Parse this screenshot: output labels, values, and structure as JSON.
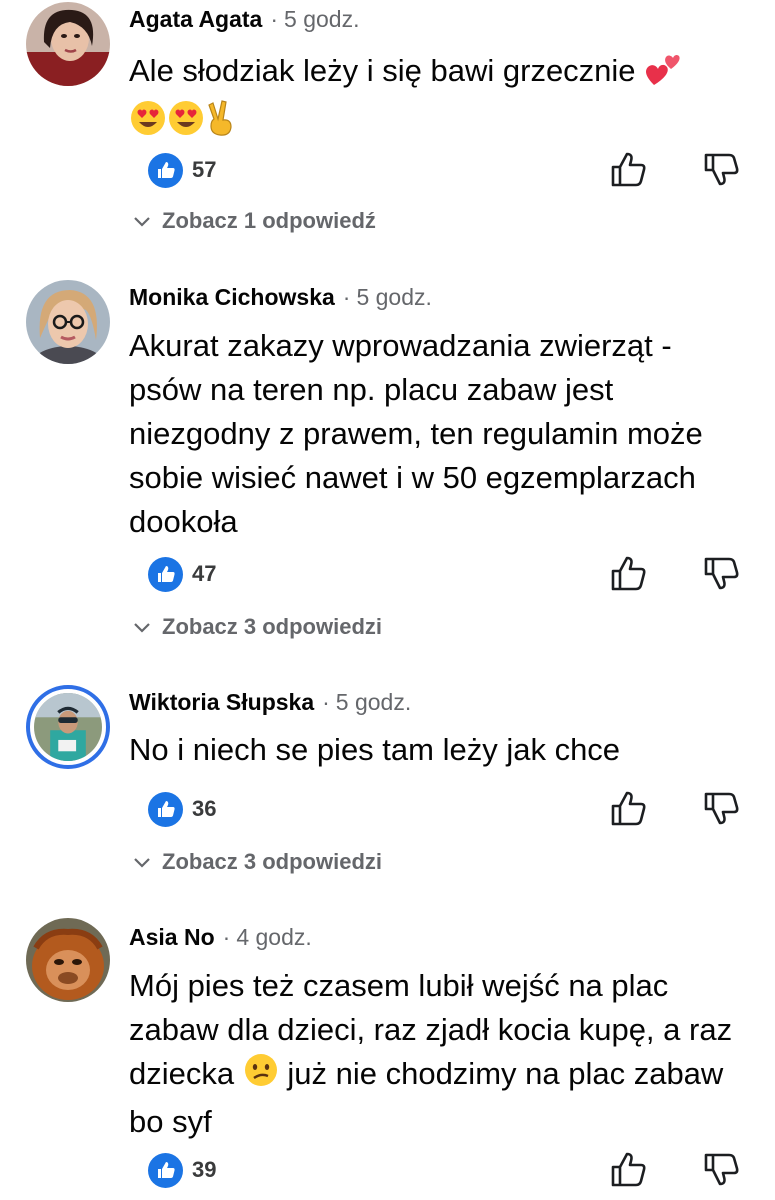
{
  "comments": [
    {
      "author": "Agata Agata",
      "time": "5 godz.",
      "text": "Ale słodziak leży i się bawi grzecznie",
      "likes": "57",
      "replies": "Zobacz 1 odpowiedź"
    },
    {
      "author": "Monika Cichowska",
      "time": "5 godz.",
      "text": "Akurat zakazy wprowadzania zwierząt - psów na teren np. placu zabaw jest niezgodny z prawem, ten regulamin może sobie wisieć nawet i w 50 egzemplarzach dookoła",
      "likes": "47",
      "replies": "Zobacz 3 odpowiedzi"
    },
    {
      "author": "Wiktoria Słupska",
      "time": "5 godz.",
      "text": "No i niech se pies tam leży jak chce",
      "likes": "36",
      "replies": "Zobacz 3 odpowiedzi"
    },
    {
      "author": "Asia No",
      "time": "4 godz.",
      "text_before": "Mój pies też czasem lubił wejść na plac zabaw dla dzieci, raz zjadł kocia kupę, a raz dziecka",
      "text_after": "już nie chodzimy na plac zabaw bo syf",
      "likes": "39"
    }
  ],
  "separator": "·",
  "icons": {
    "like": "thumbs-up-icon",
    "upvote": "thumbs-up-outline-icon",
    "downvote": "thumbs-down-outline-icon",
    "expand": "chevron-down-icon",
    "heart": "two-hearts-emoji",
    "hearteyes": "heart-eyes-emoji",
    "victory": "victory-hand-emoji",
    "confused": "confused-face-emoji"
  },
  "colors": {
    "accent": "#1b74e4",
    "secondary_text": "#65676b",
    "primary_text": "#050505"
  }
}
